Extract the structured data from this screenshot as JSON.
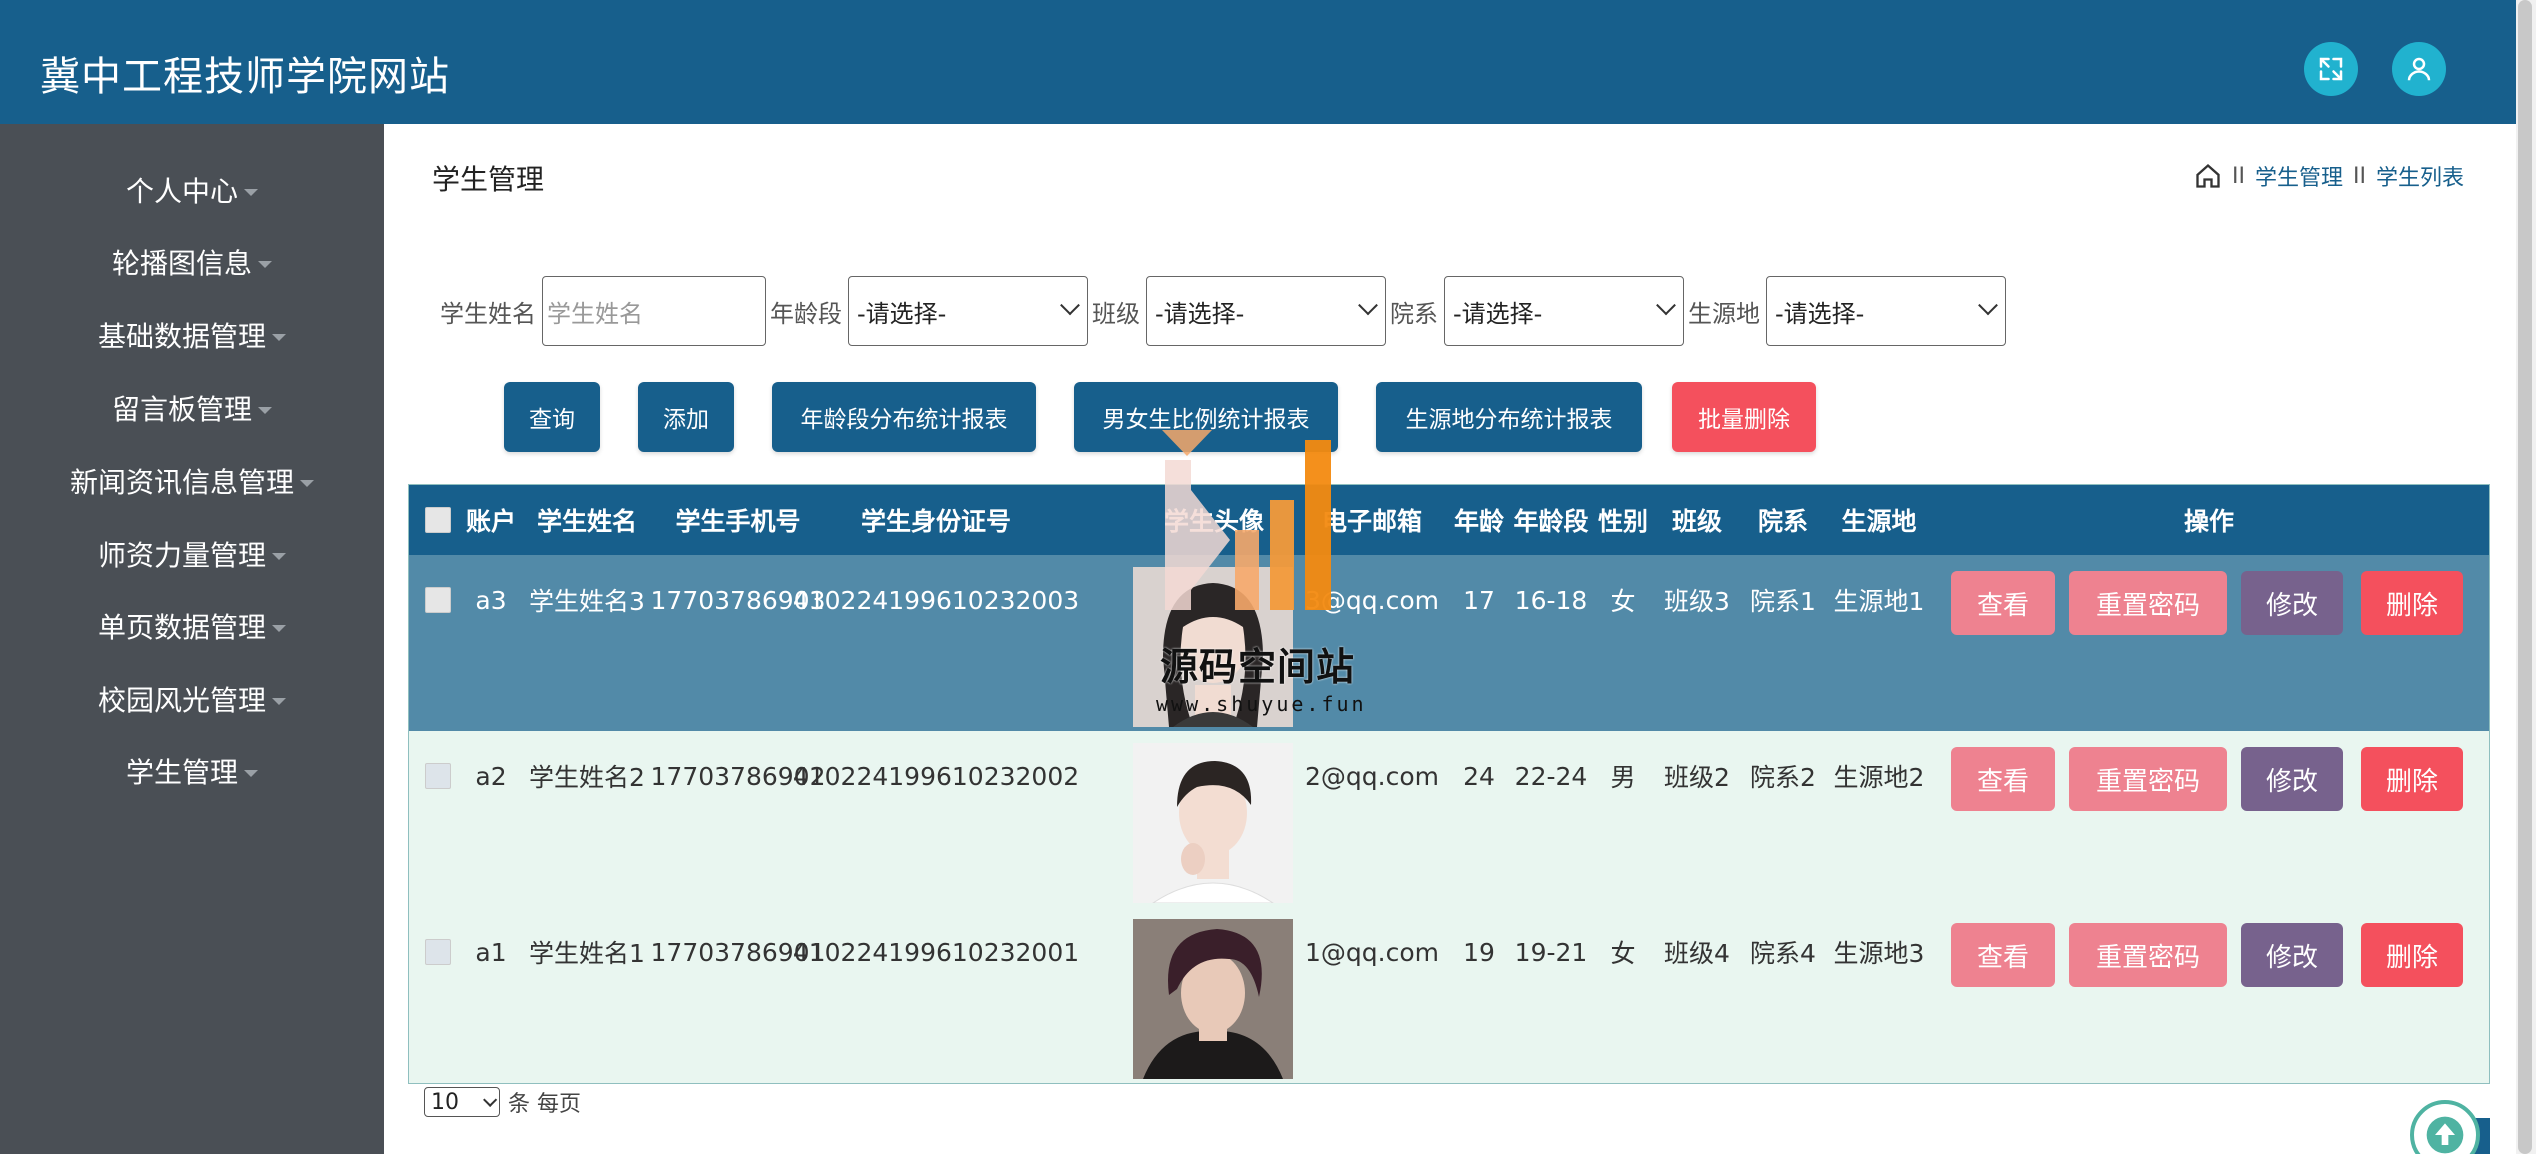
{
  "header": {
    "title": "冀中工程技师学院网站"
  },
  "sidebar": {
    "items": [
      {
        "label": "个人中心"
      },
      {
        "label": "轮播图信息"
      },
      {
        "label": "基础数据管理"
      },
      {
        "label": "留言板管理"
      },
      {
        "label": "新闻资讯信息管理"
      },
      {
        "label": "师资力量管理"
      },
      {
        "label": "单页数据管理"
      },
      {
        "label": "校园风光管理"
      },
      {
        "label": "学生管理"
      }
    ]
  },
  "page": {
    "title": "学生管理",
    "breadcrumb": {
      "sep": "II",
      "item1": "学生管理",
      "item2": "学生列表"
    }
  },
  "filters": {
    "name_label": "学生姓名",
    "name_placeholder": "学生姓名",
    "age_label": "年龄段",
    "age_value": "-请选择-",
    "class_label": "班级",
    "class_value": "-请选择-",
    "dept_label": "院系",
    "dept_value": "-请选择-",
    "origin_label": "生源地",
    "origin_value": "-请选择-"
  },
  "buttons": {
    "query": "查询",
    "add": "添加",
    "age_report": "年龄段分布统计报表",
    "gender_report": "男女生比例统计报表",
    "origin_report": "生源地分布统计报表",
    "batch_delete": "批量删除"
  },
  "table": {
    "headers": {
      "account": "账户",
      "name": "学生姓名",
      "phone": "学生手机号",
      "idcard": "学生身份证号",
      "photo": "学生头像",
      "email": "电子邮箱",
      "age": "年龄",
      "age_group": "年龄段",
      "gender": "性别",
      "class": "班级",
      "dept": "院系",
      "origin": "生源地",
      "actions": "操作"
    },
    "rows": [
      {
        "account": "a3",
        "name": "学生姓名3",
        "phone": "17703786903",
        "idcard": "410224199610232003",
        "email": "3@qq.com",
        "age": "17",
        "age_group": "16-18",
        "gender": "女",
        "class": "班级3",
        "dept": "院系1",
        "origin": "生源地1"
      },
      {
        "account": "a2",
        "name": "学生姓名2",
        "phone": "17703786902",
        "idcard": "410224199610232002",
        "email": "2@qq.com",
        "age": "24",
        "age_group": "22-24",
        "gender": "男",
        "class": "班级2",
        "dept": "院系2",
        "origin": "生源地2"
      },
      {
        "account": "a1",
        "name": "学生姓名1",
        "phone": "17703786901",
        "idcard": "410224199610232001",
        "email": "1@qq.com",
        "age": "19",
        "age_group": "19-21",
        "gender": "女",
        "class": "班级4",
        "dept": "院系4",
        "origin": "生源地3"
      }
    ],
    "actions": {
      "view": "查看",
      "reset": "重置密码",
      "edit": "修改",
      "delete": "删除"
    }
  },
  "pager": {
    "page_size": "10",
    "suffix": "条 每页"
  },
  "watermark": {
    "title": "源码空间站",
    "url": "www.shuyue.fun"
  },
  "colors": {
    "primary": "#175f8c",
    "sidebar": "#4a4f55",
    "danger": "#f4505d",
    "pink": "#ee8290",
    "purple": "#77628d",
    "selected_row": "#528aa8",
    "row_bg": "#e9f6f0"
  }
}
